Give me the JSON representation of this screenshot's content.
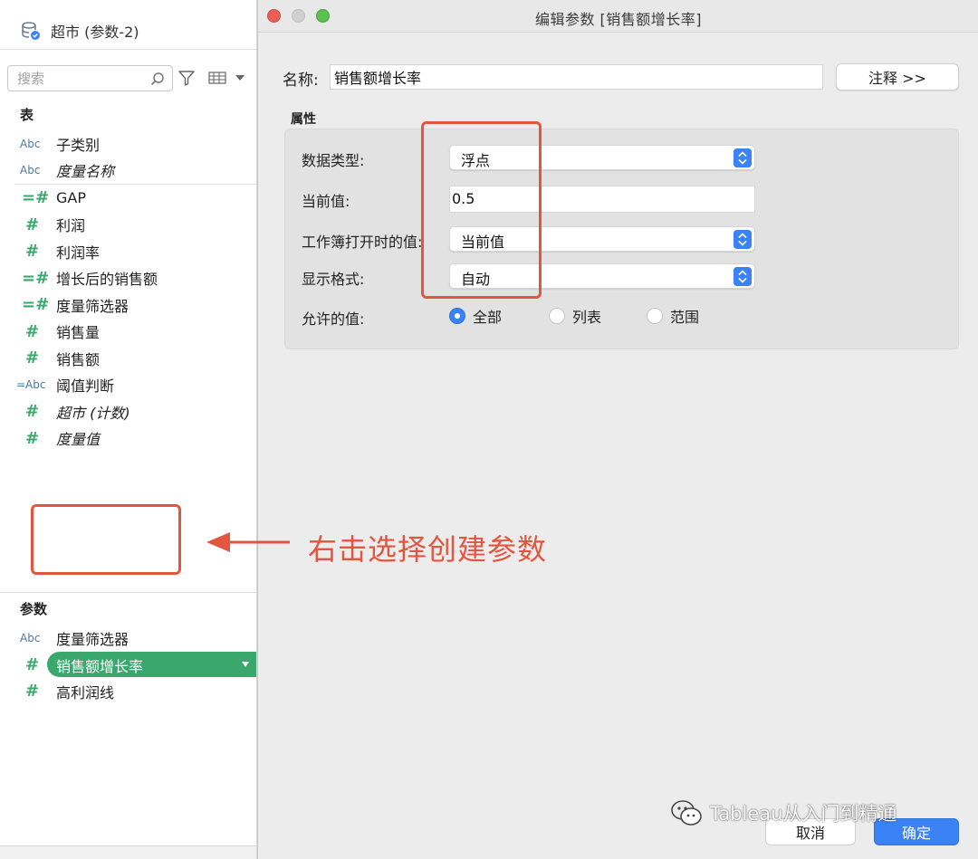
{
  "data_pane": {
    "datasource_name": "超市 (参数-2)",
    "search_placeholder": "搜索",
    "tables_heading": "表",
    "fields": [
      {
        "type": "Abc",
        "label": "子类别",
        "italic": false
      },
      {
        "type": "Abc",
        "label": "度量名称",
        "italic": true
      },
      {
        "type": "=#",
        "label": "GAP",
        "italic": false
      },
      {
        "type": "#",
        "label": "利润",
        "italic": false
      },
      {
        "type": "#",
        "label": "利润率",
        "italic": false
      },
      {
        "type": "=#",
        "label": "增长后的销售额",
        "italic": false
      },
      {
        "type": "=#",
        "label": "度量筛选器",
        "italic": false
      },
      {
        "type": "#",
        "label": "销售量",
        "italic": false
      },
      {
        "type": "#",
        "label": "销售额",
        "italic": false
      },
      {
        "type": "=Abc",
        "label": "阈值判断",
        "italic": false
      },
      {
        "type": "#",
        "label": "超市 (计数)",
        "italic": true
      },
      {
        "type": "#",
        "label": "度量值",
        "italic": true
      }
    ],
    "parameters_heading": "参数",
    "parameters": [
      {
        "type": "Abc",
        "label": "度量筛选器",
        "selected": false
      },
      {
        "type": "#",
        "label": "销售额增长率",
        "selected": true
      },
      {
        "type": "#",
        "label": "高利润线",
        "selected": false
      }
    ]
  },
  "dialog": {
    "title": "编辑参数 [销售额增长率]",
    "name_label": "名称:",
    "name_value": "销售额增长率",
    "comment_button": "注释 >>",
    "properties_heading": "属性",
    "data_type_label": "数据类型:",
    "data_type_value": "浮点",
    "current_value_label": "当前值:",
    "current_value": "0.5",
    "workbook_open_label": "工作簿打开时的值:",
    "workbook_open_value": "当前值",
    "display_format_label": "显示格式:",
    "display_format_value": "自动",
    "allowed_values_label": "允许的值:",
    "allowed_values": [
      {
        "label": "全部",
        "checked": true
      },
      {
        "label": "列表",
        "checked": false
      },
      {
        "label": "范围",
        "checked": false
      }
    ],
    "cancel_button": "取消",
    "ok_button": "确定"
  },
  "annotation": {
    "text": "右击选择创建参数",
    "color": "#e2553f"
  },
  "watermark": {
    "text": "Tableau从入门到精通"
  },
  "colors": {
    "accent_blue": "#3b82f6",
    "measure_green": "#3aa76d",
    "dimension_blue": "#4a79a5",
    "annotation_red": "#e2553f"
  }
}
